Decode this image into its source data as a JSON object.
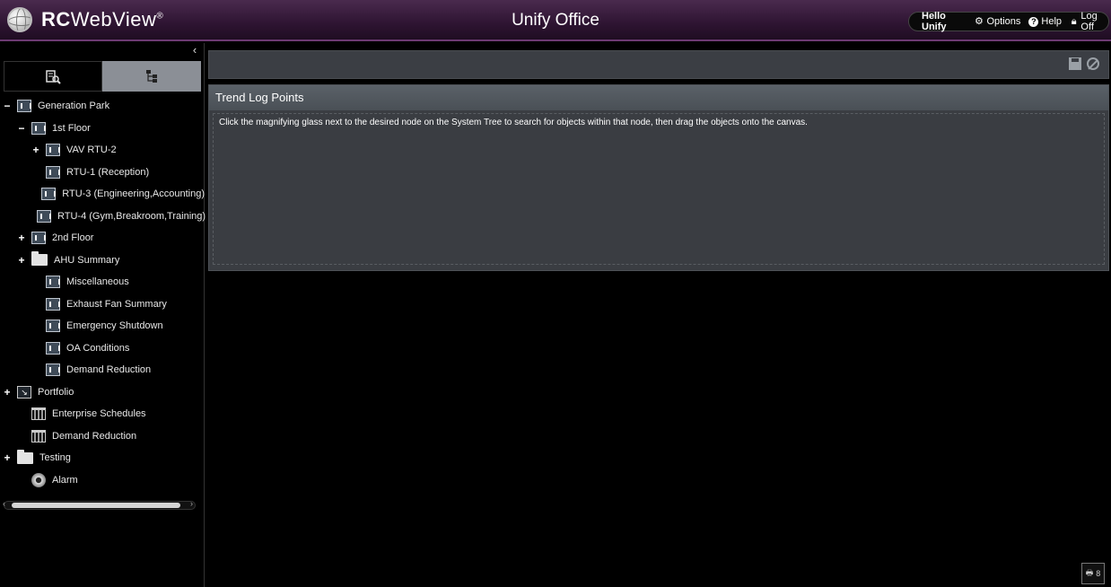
{
  "header": {
    "logo_bold": "RC",
    "logo_rest": "WebView",
    "logo_mark": "®",
    "title": "Unify Office",
    "greeting": "Hello Unify",
    "options_label": "Options",
    "help_label": "Help",
    "logoff_label": "Log Off"
  },
  "sidebar": {
    "collapse_glyph": "‹",
    "tree": [
      {
        "label": "Generation Park",
        "toggle": "−",
        "icon": "node",
        "level": 0
      },
      {
        "label": "1st Floor",
        "toggle": "−",
        "icon": "node",
        "level": 1
      },
      {
        "label": "VAV RTU-2",
        "toggle": "+",
        "icon": "node",
        "level": 2
      },
      {
        "label": "RTU-1 (Reception)",
        "toggle": "",
        "icon": "node",
        "level": 3
      },
      {
        "label": "RTU-3 (Engineering,Accounting)",
        "toggle": "",
        "icon": "node",
        "level": 3
      },
      {
        "label": "RTU-4 (Gym,Breakroom,Training)",
        "toggle": "",
        "icon": "node",
        "level": 3
      },
      {
        "label": "2nd Floor",
        "toggle": "+",
        "icon": "node",
        "level": 1
      },
      {
        "label": "AHU Summary",
        "toggle": "+",
        "icon": "folder",
        "level": 1
      },
      {
        "label": "Miscellaneous",
        "toggle": "",
        "icon": "node",
        "level": 2
      },
      {
        "label": "Exhaust Fan Summary",
        "toggle": "",
        "icon": "node",
        "level": 2
      },
      {
        "label": "Emergency Shutdown",
        "toggle": "",
        "icon": "node",
        "level": 2
      },
      {
        "label": "OA Conditions",
        "toggle": "",
        "icon": "node",
        "level": 2
      },
      {
        "label": "Demand Reduction",
        "toggle": "",
        "icon": "node",
        "level": 2
      },
      {
        "label": "Portfolio",
        "toggle": "+",
        "icon": "portfolio",
        "level": 0
      },
      {
        "label": "Enterprise Schedules",
        "toggle": "",
        "icon": "calendar",
        "level": 1
      },
      {
        "label": "Demand Reduction",
        "toggle": "",
        "icon": "calendar",
        "level": 1
      },
      {
        "label": "Testing",
        "toggle": "+",
        "icon": "folder",
        "level": 0
      },
      {
        "label": "Alarm",
        "toggle": "",
        "icon": "alarm",
        "level": 1
      }
    ]
  },
  "main": {
    "panel_title": "Trend Log Points",
    "panel_text": "Click the magnifying glass next to the desired node on the System Tree to search for objects within that node, then drag the objects onto the canvas.",
    "corner_count": "8"
  },
  "colors": {
    "header_bg": "#2e1432",
    "panel_bg": "#3a3d42",
    "active_tab": "#8b8f96"
  }
}
